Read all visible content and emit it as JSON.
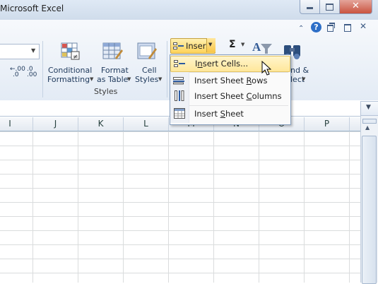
{
  "window": {
    "title": "Microsoft Excel"
  },
  "ribbon": {
    "number_decrease_decimal": ".00",
    "number_increase_decimal": ".0",
    "styles_group": {
      "label": "Styles",
      "conditional_formatting": [
        "Conditional",
        "Formatting"
      ],
      "format_as_table": [
        "Format",
        "as Table"
      ],
      "cell_styles": [
        "Cell",
        "Styles"
      ]
    },
    "cells_group": {
      "insert_label": "Insert"
    },
    "editing_group": {
      "sum_symbol": "Σ",
      "find_select": [
        "nd &",
        "lect"
      ]
    }
  },
  "insert_menu": {
    "items": [
      {
        "pre": "I",
        "accel": "n",
        "post": "sert Cells...",
        "icon": "insert-cells-icon",
        "highlighted": true
      },
      {
        "pre": "Insert Sheet ",
        "accel": "R",
        "post": "ows",
        "icon": "insert-rows-icon"
      },
      {
        "pre": "Insert Sheet ",
        "accel": "C",
        "post": "olumns",
        "icon": "insert-columns-icon"
      },
      {
        "pre": "Insert ",
        "accel": "S",
        "post": "heet",
        "icon": "insert-sheet-icon"
      }
    ]
  },
  "grid": {
    "columns": [
      "I",
      "J",
      "K",
      "L",
      "M",
      "N",
      "O",
      "P"
    ]
  },
  "colors": {
    "accent": "#ffd35a",
    "ribbon_bg": "#e3ebf5",
    "close_button": "#c9533f"
  }
}
